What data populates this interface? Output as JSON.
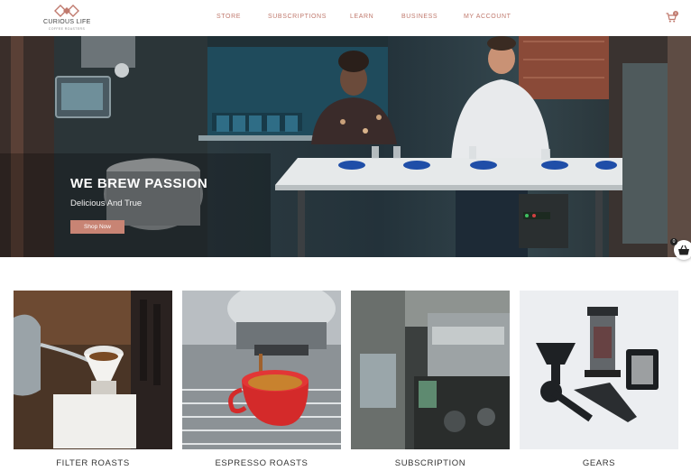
{
  "brand": {
    "name": "CURIOUS LIFE",
    "tagline": "COFFEE ROASTERS",
    "accent_color": "#c07a6e"
  },
  "nav": {
    "items": [
      {
        "label": "STORE"
      },
      {
        "label": "SUBSCRIPTIONS"
      },
      {
        "label": "LEARN"
      },
      {
        "label": "BUSINESS"
      },
      {
        "label": "MY ACCOUNT"
      }
    ],
    "cart_icon": "cart-icon",
    "cart_count": "0"
  },
  "hero": {
    "title": "WE BREW PASSION",
    "subtitle": "Delicious And True",
    "button_label": "Shop Now",
    "button_color": "#c88474"
  },
  "floating_cart": {
    "icon": "basket-icon",
    "count": "0"
  },
  "categories": [
    {
      "label": "FILTER ROASTS"
    },
    {
      "label": "ESPRESSO ROASTS"
    },
    {
      "label": "SUBSCRIPTION"
    },
    {
      "label": "GEARS"
    }
  ]
}
